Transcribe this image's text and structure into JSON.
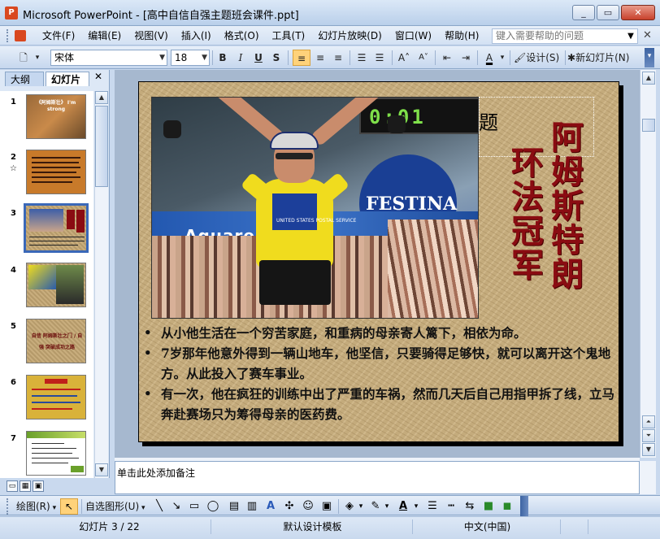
{
  "window": {
    "app_name": "Microsoft PowerPoint",
    "title": "Microsoft PowerPoint - [高中自信自强主题班会课件.ppt]",
    "buttons": {
      "minimize": "_",
      "restore": "▭",
      "close": "✕"
    }
  },
  "menubar": {
    "items": [
      "文件(F)",
      "编辑(E)",
      "视图(V)",
      "插入(I)",
      "格式(O)",
      "工具(T)",
      "幻灯片放映(D)",
      "窗口(W)",
      "帮助(H)"
    ],
    "help_placeholder": "键入需要帮助的问题"
  },
  "format_toolbar": {
    "font": "宋体",
    "font_size": "18",
    "bold": "B",
    "italic": "I",
    "underline": "U",
    "shadow": "S",
    "design_label": "设计(S)",
    "new_slide_label": "新幻灯片(N)"
  },
  "left_panel": {
    "tabs": [
      "大纲",
      "幻灯片"
    ],
    "close": "✕",
    "slides": [
      {
        "num": "1",
        "caption": "《阿姆斯壮》 I'm strong"
      },
      {
        "num": "2",
        "caption": ""
      },
      {
        "num": "3",
        "caption": ""
      },
      {
        "num": "4",
        "caption": ""
      },
      {
        "num": "5",
        "caption": "自信 阿姆斯壮之门 / 自强 突破成功之路"
      },
      {
        "num": "6",
        "caption": ""
      },
      {
        "num": "7",
        "caption": ""
      }
    ]
  },
  "slide": {
    "photo": {
      "clock": "0:01",
      "banner": "Aquarel",
      "sponsor": "FESTINA",
      "patch": "UNITED STATES POSTAL SERVICE"
    },
    "title_placeholder_char": "题",
    "vertical_title_1": "阿姆斯特朗",
    "vertical_title_2": "环法冠军",
    "bullets": [
      "从小他生活在一个穷苦家庭，和重病的母亲寄人篱下，相依为命。",
      "7岁那年他意外得到一辆山地车，他坚信，只要骑得足够快，就可以离开这个鬼地方。从此投入了赛车事业。",
      "有一次，他在疯狂的训练中出了严重的车祸，然而几天后自己用指甲拆了线，立马奔赴赛场只为筹得母亲的医药费。"
    ]
  },
  "notes": {
    "placeholder": "单击此处添加备注"
  },
  "draw_toolbar": {
    "draw_label": "绘图(R)",
    "autoshapes_label": "自选图形(U)"
  },
  "status": {
    "slide_counter": "幻灯片 3 / 22",
    "template": "默认设计模板",
    "language": "中文(中国)"
  }
}
